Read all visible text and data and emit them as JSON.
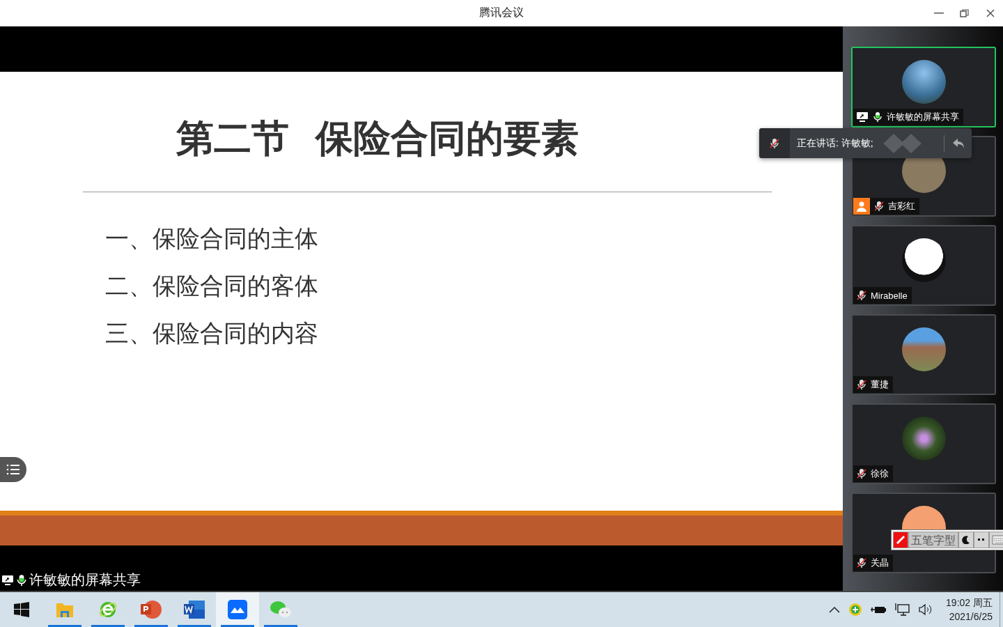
{
  "window": {
    "title": "腾讯会议"
  },
  "shared_screen": {
    "slide_title": "第二节  保险合同的要素",
    "items": [
      "一、保险合同的主体",
      "二、保险合同的客体",
      "三、保险合同的内容"
    ],
    "sharer_label": "许敏敏的屏幕共享",
    "sharer_mic_on": true
  },
  "participants": [
    {
      "name": "许敏敏的屏幕共享",
      "muted": false,
      "sharing": true,
      "highlighted": true,
      "user_badge": false
    },
    {
      "name": "吉彩红",
      "muted": true,
      "sharing": false,
      "highlighted": false,
      "user_badge": true
    },
    {
      "name": "Mirabelle",
      "muted": true,
      "sharing": false,
      "highlighted": false,
      "user_badge": false
    },
    {
      "name": "董捷",
      "muted": true,
      "sharing": false,
      "highlighted": false,
      "user_badge": false
    },
    {
      "name": "徐徐",
      "muted": true,
      "sharing": false,
      "highlighted": false,
      "user_badge": false
    },
    {
      "name": "关晶",
      "muted": true,
      "sharing": false,
      "highlighted": false,
      "user_badge": false
    }
  ],
  "speaking_toast": {
    "label": "正在讲话: 许敏敏;",
    "mic_muted": true
  },
  "ime_bar": {
    "label": "五笔字型"
  },
  "taskbar": {
    "apps": [
      {
        "kind": "start",
        "running": false,
        "selected": false
      },
      {
        "kind": "explorer",
        "running": true,
        "selected": false
      },
      {
        "kind": "browser",
        "running": true,
        "selected": false
      },
      {
        "kind": "slides",
        "running": true,
        "selected": false
      },
      {
        "kind": "word",
        "running": true,
        "selected": false
      },
      {
        "kind": "meeting",
        "running": true,
        "selected": true
      },
      {
        "kind": "chat",
        "running": true,
        "selected": false
      }
    ],
    "time": "19:02 周五",
    "date": "2021/6/25"
  }
}
